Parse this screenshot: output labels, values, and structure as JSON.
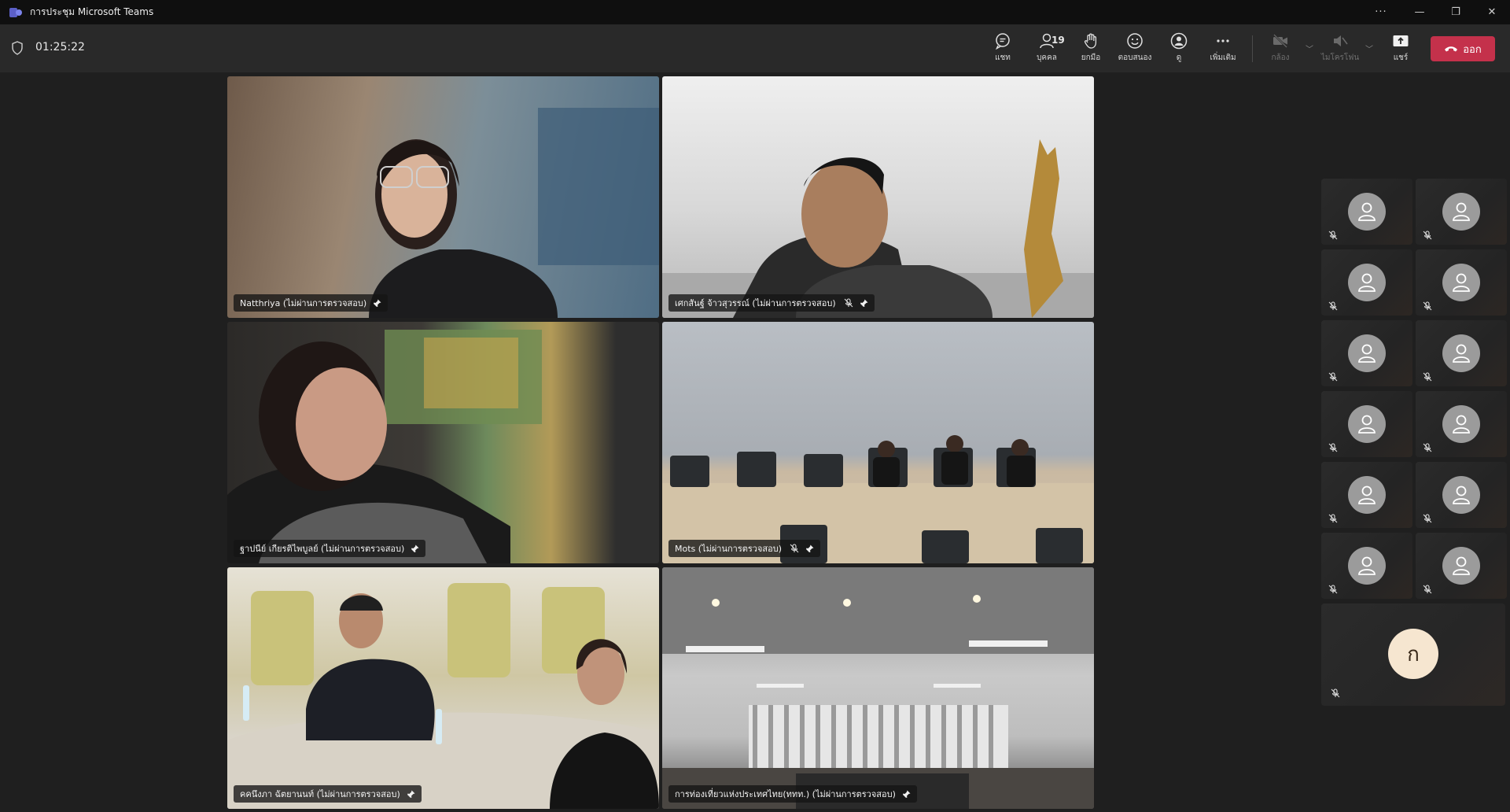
{
  "window": {
    "title": "การประชุม Microsoft Teams",
    "more": "···",
    "minimize": "—",
    "restore": "❐",
    "close": "✕"
  },
  "meeting": {
    "timer": "01:25:22"
  },
  "toolbar": {
    "chat": "แชท",
    "people": "บุคคล",
    "people_count": "19",
    "raise": "ยกมือ",
    "react": "ตอบสนอง",
    "view": "ดู",
    "more": "เพิ่มเติม",
    "camera": "กล้อง",
    "mic": "ไมโครโฟน",
    "share": "แชร์",
    "leave": "ออก"
  },
  "video_tiles": [
    {
      "name": "Natthriya (ไม่ผ่านการตรวจสอบ)",
      "muted": false,
      "pinned": true
    },
    {
      "name": "เศกสันฐ์ จ้าวสุวรรณ์ (ไม่ผ่านการตรวจสอบ)",
      "muted": true,
      "pinned": true
    },
    {
      "name": "ฐาปนีย์ เกียรติไพบูลย์ (ไม่ผ่านการตรวจสอบ)",
      "muted": false,
      "pinned": true
    },
    {
      "name": "Mots (ไม่ผ่านการตรวจสอบ)",
      "muted": true,
      "pinned": true
    },
    {
      "name": "คคนึงภา ฉัตยานนท์ (ไม่ผ่านการตรวจสอบ)",
      "muted": false,
      "pinned": true
    },
    {
      "name": "การท่องเที่ยวแห่งประเทศไทย(ททท.) (ไม่ผ่านการตรวจสอบ)",
      "muted": false,
      "pinned": true
    }
  ],
  "gallery": {
    "last_initial": "ก"
  },
  "colors": {
    "leave": "#c4314b",
    "bg": "#1f1f1f",
    "toolbar": "#292929"
  }
}
